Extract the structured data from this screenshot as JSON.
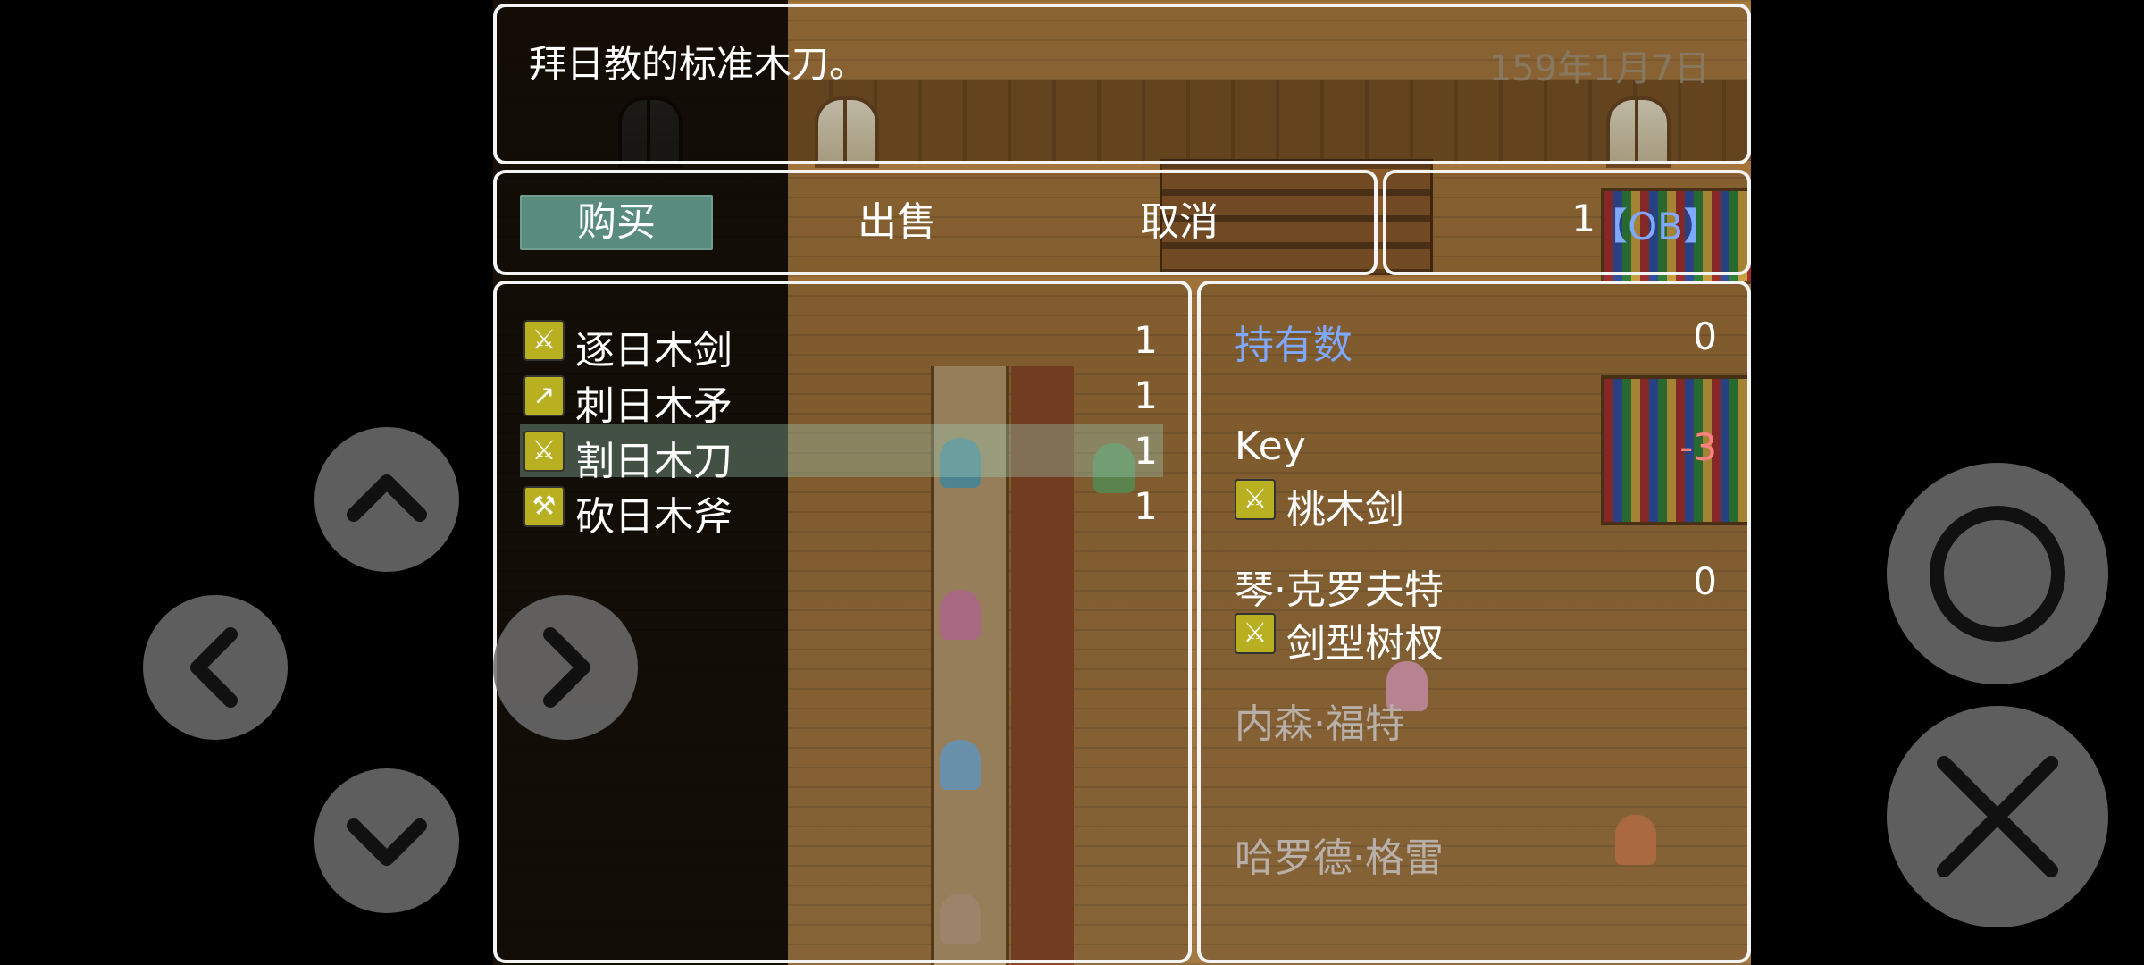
{
  "help": {
    "text": "拜日教的标准木刀。",
    "date": "159年1月7日"
  },
  "commands": {
    "buy": "购买",
    "sell": "出售",
    "cancel": "取消"
  },
  "gold": {
    "value": "1",
    "unit": "【OB】"
  },
  "shop_items": [
    {
      "name": "逐日木剑",
      "price": "1",
      "icon": "sword-icon"
    },
    {
      "name": "刺日木矛",
      "price": "1",
      "icon": "spear-icon"
    },
    {
      "name": "割日木刀",
      "price": "1",
      "icon": "sword-icon"
    },
    {
      "name": "砍日木斧",
      "price": "1",
      "icon": "axe-icon"
    }
  ],
  "status": {
    "possession_label": "持有数",
    "possession_value": "0",
    "actors": [
      {
        "name": "Key",
        "change": "-3",
        "equipped": "桃木剑"
      },
      {
        "name": "琴·克罗夫特",
        "change": "0",
        "equipped": "剑型树杈"
      },
      {
        "name": "内森·福特"
      },
      {
        "name": "哈罗德·格雷"
      }
    ]
  },
  "colors": {
    "selected_command": "#5a8c7e",
    "system_blue": "#7fa8ff",
    "negative": "#ff8080",
    "disabled": "#b8b0a8",
    "panel_border": "#f4f4f4"
  }
}
